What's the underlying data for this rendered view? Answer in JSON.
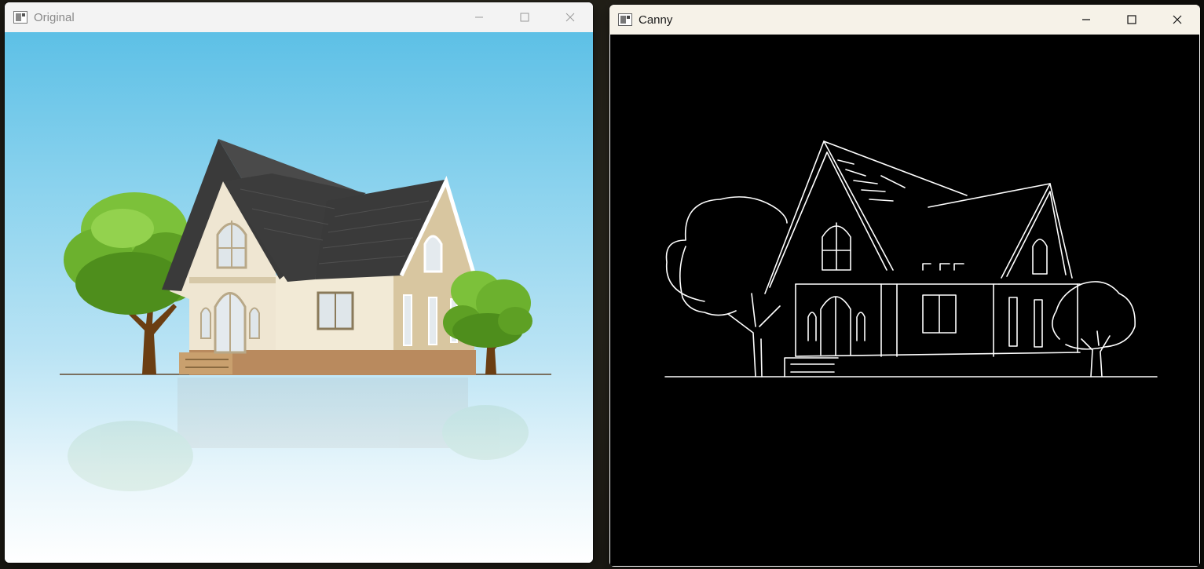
{
  "windows": {
    "original": {
      "title": "Original"
    },
    "canny": {
      "title": "Canny"
    }
  },
  "icons": {
    "app": "app-window-icon",
    "minimize": "minimize-icon",
    "maximize": "maximize-icon",
    "close": "close-icon"
  },
  "colors": {
    "sky_top": "#5dc0e6",
    "canny_background": "#000000",
    "canny_edges": "#ffffff",
    "roof": "#3a3a3a",
    "foliage": "#7cc13a",
    "wall": "#efe6d2"
  }
}
